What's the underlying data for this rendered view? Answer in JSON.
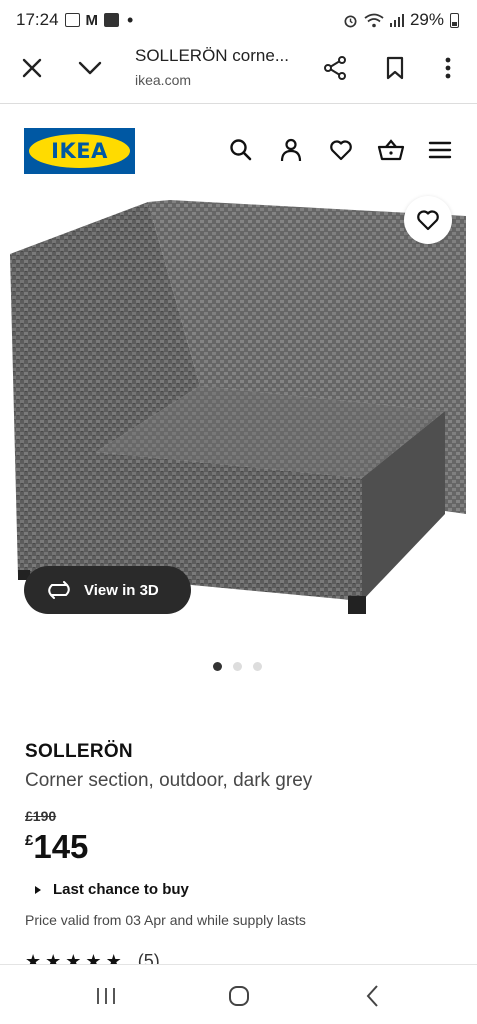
{
  "status_bar": {
    "time": "17:24",
    "battery": "29%"
  },
  "browser": {
    "title": "SOLLERÖN corne...",
    "url": "ikea.com",
    "close_icon": "close-icon",
    "chevron_icon": "chevron-down-icon",
    "share_icon": "share-icon",
    "bookmark_icon": "bookmark-icon",
    "more_icon": "more-vertical-icon"
  },
  "header": {
    "logo_text": "IKEA",
    "icons": [
      "search-icon",
      "user-icon",
      "heart-icon",
      "basket-icon",
      "menu-icon"
    ]
  },
  "gallery": {
    "view_3d_label": "View in 3D",
    "image_count": 3,
    "active_index": 0
  },
  "product": {
    "name": "SOLLERÖN",
    "description": "Corner section, outdoor, dark grey",
    "old_price": "£190",
    "currency": "£",
    "price": "145",
    "last_chance": "Last chance to buy",
    "price_valid": "Price valid from 03 Apr and while supply lasts",
    "review_count": "(5)"
  },
  "colors": {
    "ikea_blue": "#0058a3",
    "ikea_yellow": "#ffdb00",
    "pill_bg": "#2a2a2a"
  }
}
